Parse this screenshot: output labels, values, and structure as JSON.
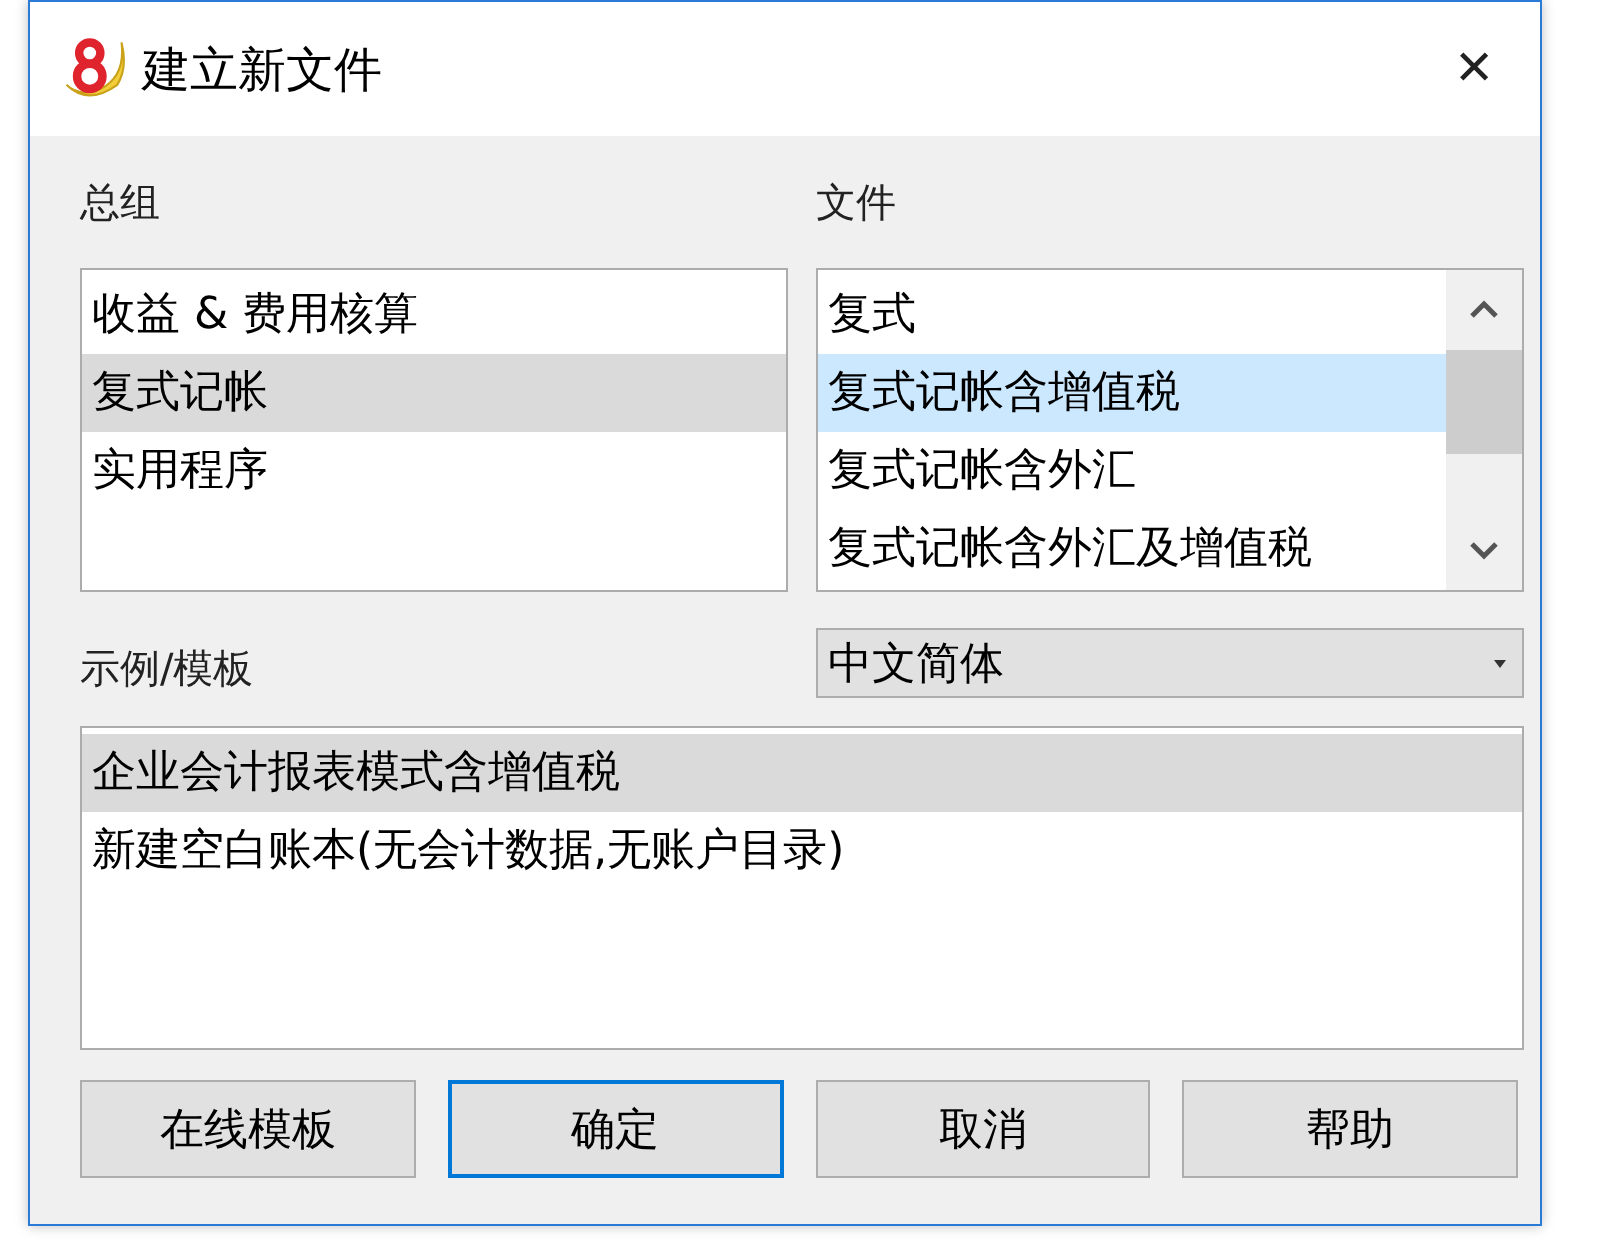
{
  "window": {
    "title": "建立新文件",
    "close": "✕"
  },
  "groups": {
    "label": "总组",
    "items": [
      {
        "label": "收益 & 费用核算",
        "selected": false
      },
      {
        "label": "复式记帐",
        "selected": true
      },
      {
        "label": "实用程序",
        "selected": false
      }
    ]
  },
  "files": {
    "label": "文件",
    "items": [
      {
        "label": "复式",
        "selected": false
      },
      {
        "label": "复式记帐含增值税",
        "selected": true
      },
      {
        "label": "复式记帐含外汇",
        "selected": false
      },
      {
        "label": "复式记帐含外汇及增值税",
        "selected": false
      }
    ]
  },
  "templates": {
    "label": "示例/模板",
    "language": "中文简体",
    "items": [
      {
        "label": "企业会计报表模式含增值税",
        "selected": true
      },
      {
        "label": "新建空白账本(无会计数据,无账户目录)",
        "selected": false
      }
    ]
  },
  "buttons": [
    {
      "label": "在线模板",
      "focused": false
    },
    {
      "label": "确定",
      "focused": true
    },
    {
      "label": "取消",
      "focused": false
    },
    {
      "label": "帮助",
      "focused": false
    }
  ]
}
